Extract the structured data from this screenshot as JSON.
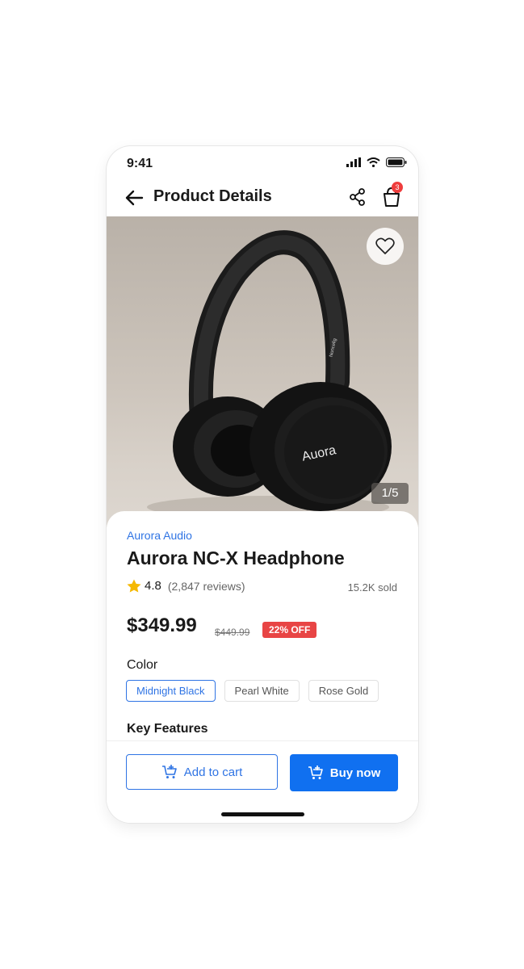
{
  "status_bar": {
    "time": "9:41"
  },
  "header": {
    "title": "Product Details",
    "cart_count": "3"
  },
  "gallery": {
    "counter": "1/5",
    "headphone_logo": "Auora",
    "headband_text": "Noncelig"
  },
  "product": {
    "brand": "Aurora Audio",
    "name": "Aurora NC-X Headphone",
    "rating": "4.8",
    "reviews": "(2,847 reviews)",
    "sold": "15.2K sold",
    "price": "$349.99",
    "original_price": "$449.99",
    "discount": "22% OFF"
  },
  "color_section": {
    "label": "Color",
    "options": [
      "Midnight Black",
      "Pearl White",
      "Rose Gold"
    ],
    "selected": "Midnight Black"
  },
  "features_section": {
    "label": "Key Features"
  },
  "actions": {
    "add_to_cart": "Add to cart",
    "buy_now": "Buy now"
  },
  "colors": {
    "accent": "#2f74e4",
    "buy_button": "#1070f0",
    "discount": "#e84545",
    "star": "#f5b800"
  }
}
